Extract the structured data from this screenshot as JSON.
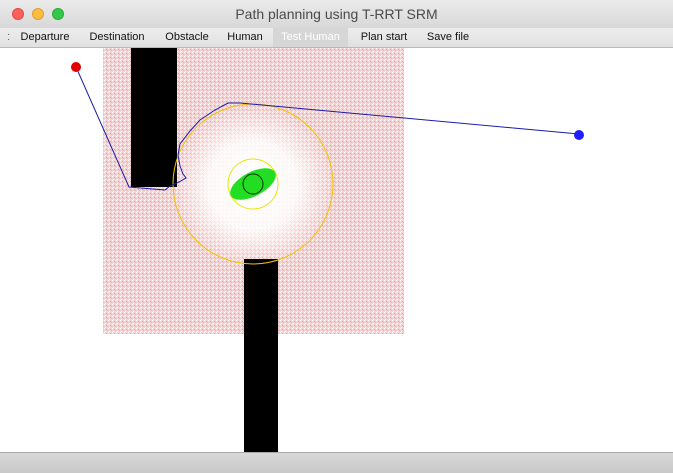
{
  "window": {
    "title": "Path planning using T-RRT SRM"
  },
  "toolbar": {
    "items": [
      {
        "label": "Departure"
      },
      {
        "label": "Destination"
      },
      {
        "label": "Obstacle"
      },
      {
        "label": "Human"
      },
      {
        "label": "Test Human",
        "selected": true
      },
      {
        "label": "Plan start"
      },
      {
        "label": "Save file"
      }
    ]
  },
  "canvas": {
    "departure": {
      "color": "#e00000"
    },
    "destination": {
      "color": "#2020ff"
    },
    "path_color": "#1a1aaa",
    "cost_field_color": "#f4b8b8",
    "human_color": "#22dd22",
    "comfort_zone_color": "#f2c200",
    "inner_zone_color": "#e8e800",
    "obstacle_color": "#000000"
  }
}
